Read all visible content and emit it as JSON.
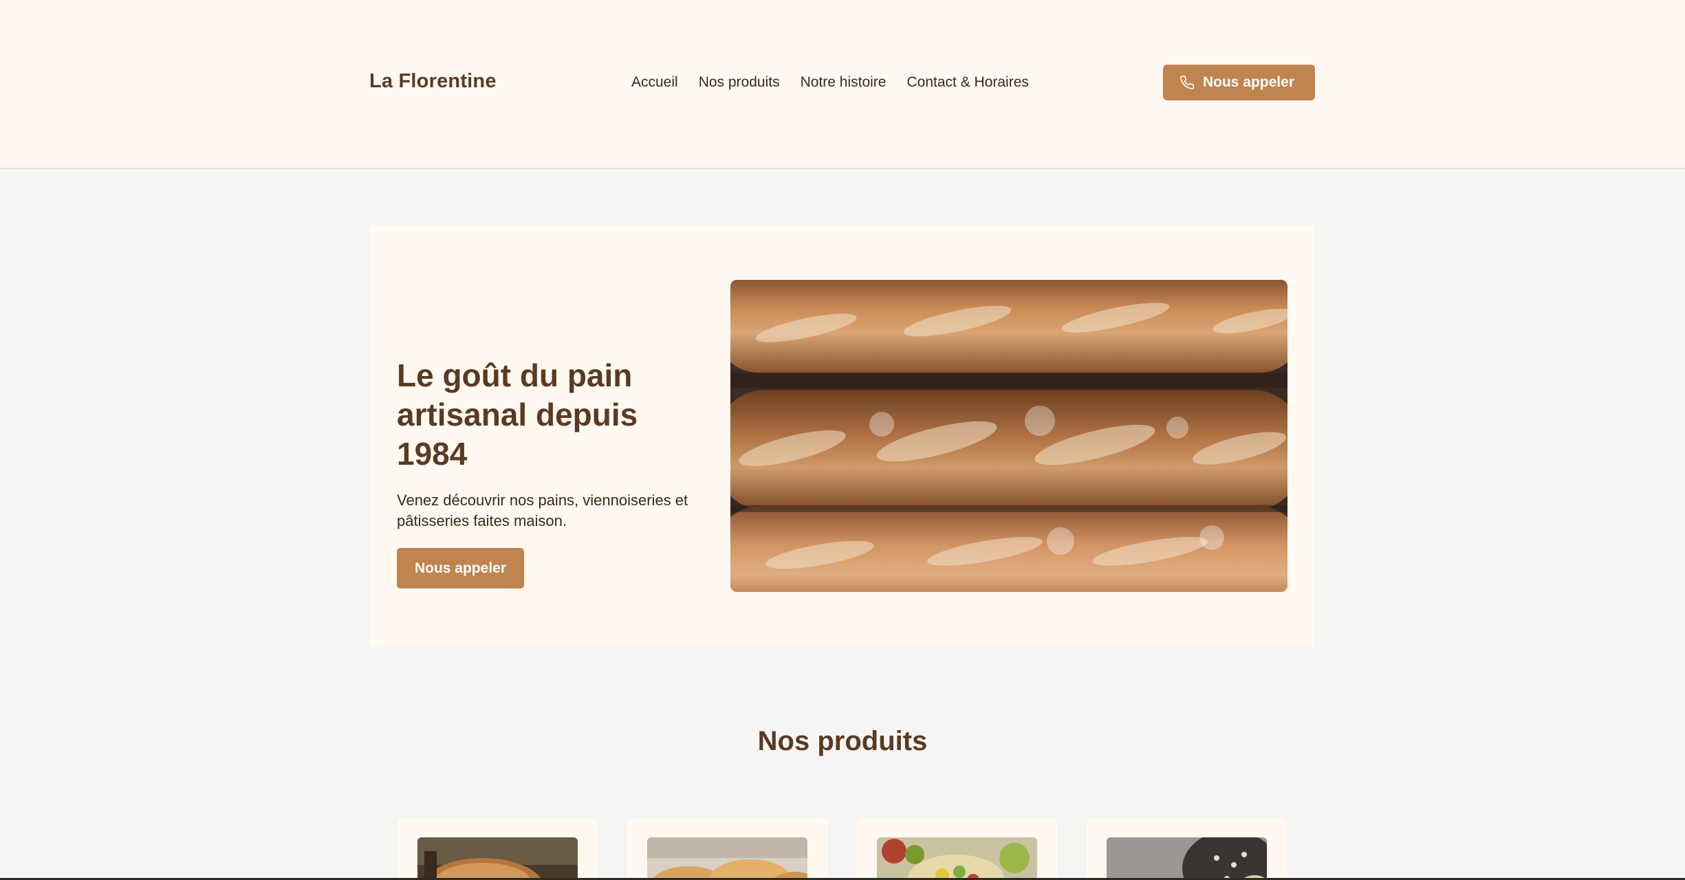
{
  "header": {
    "brand": "La Florentine",
    "nav": [
      "Accueil",
      "Nos produits",
      "Notre histoire",
      "Contact & Horaires"
    ],
    "call_label": "Nous appeler",
    "call_icon": "phone-icon"
  },
  "hero": {
    "title_line1": "Le goût du pain",
    "title_line2": "artisanal depuis 1984",
    "subtitle_line1": "Venez découvrir nos pains, viennoiseries et",
    "subtitle_line2": "pâtisseries faites maison.",
    "button_label": "Nous appeler",
    "image": "baguettes-photo"
  },
  "products": {
    "title": "Nos produits",
    "items": [
      {
        "image": "bread-photo"
      },
      {
        "image": "croissants-photo"
      },
      {
        "image": "fruit-pastries-photo"
      },
      {
        "image": "dough-photo"
      }
    ]
  },
  "colors": {
    "accent": "#c0844e",
    "brown": "#5a3a22",
    "cream": "#fff9f2",
    "background": "#f5f5f4"
  }
}
